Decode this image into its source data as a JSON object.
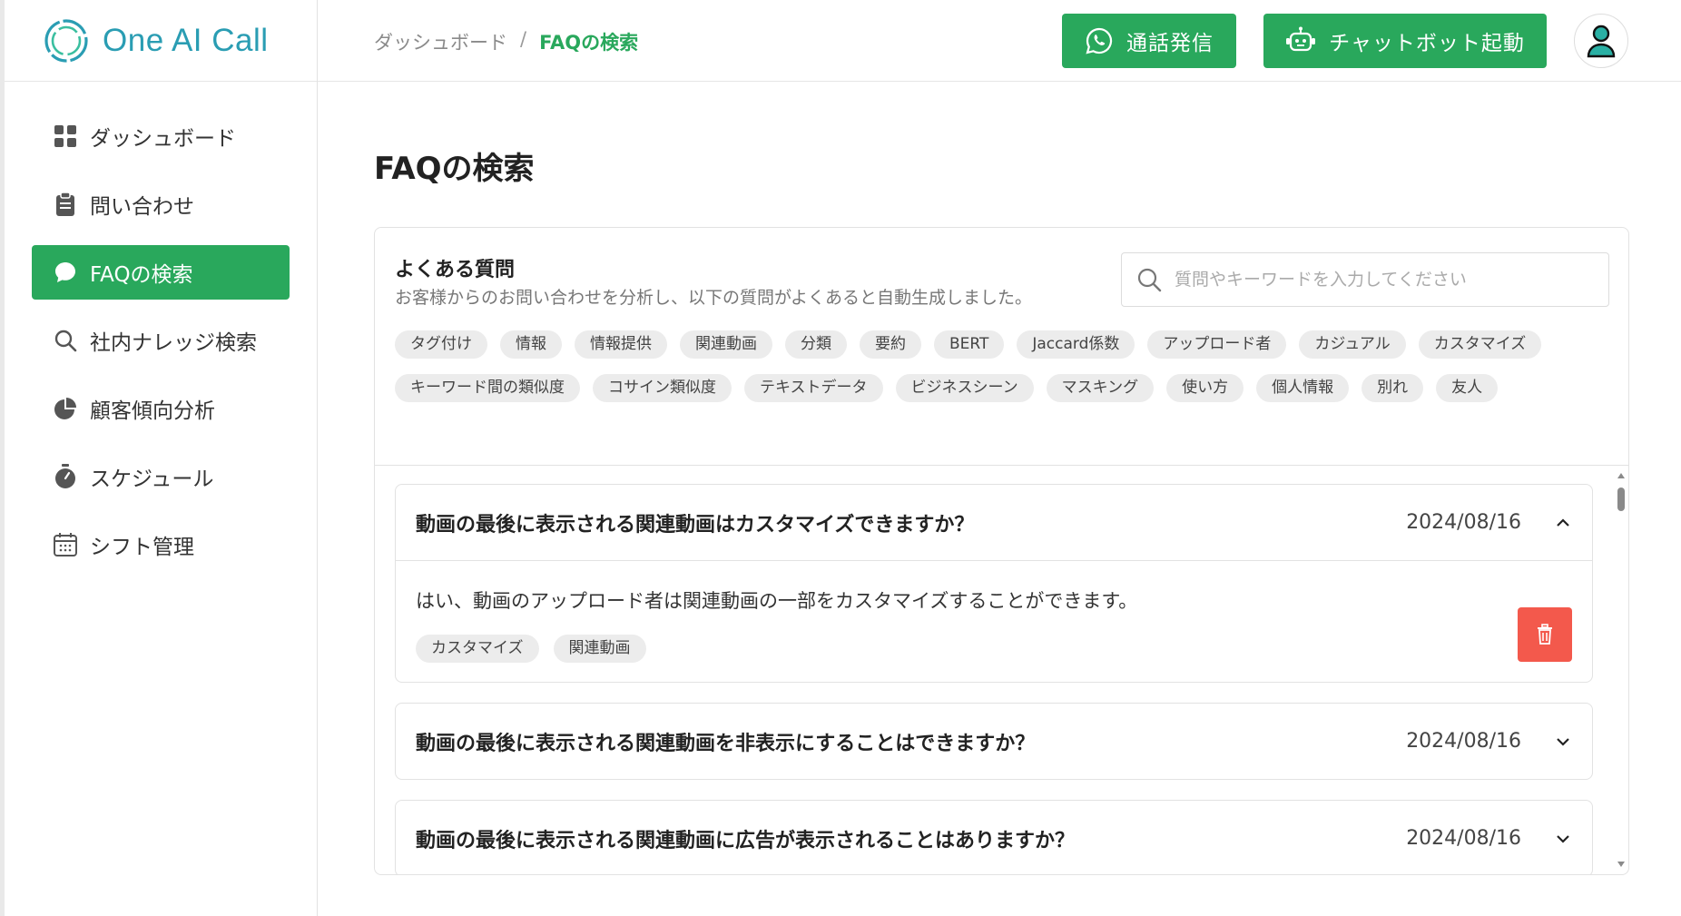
{
  "brand": {
    "name": "One AI Call",
    "color": "#2a9db3"
  },
  "accent": "#29a85c",
  "danger": "#f3594c",
  "sidebar": {
    "items": [
      {
        "label": "ダッシュボード",
        "icon": "grid-icon",
        "active": false
      },
      {
        "label": "問い合わせ",
        "icon": "clipboard-icon",
        "active": false
      },
      {
        "label": "FAQの検索",
        "icon": "chat-bubble-icon",
        "active": true
      },
      {
        "label": "社内ナレッジ検索",
        "icon": "search-icon",
        "active": false
      },
      {
        "label": "顧客傾向分析",
        "icon": "pie-chart-icon",
        "active": false
      },
      {
        "label": "スケジュール",
        "icon": "timer-icon",
        "active": false
      },
      {
        "label": "シフト管理",
        "icon": "calendar-icon",
        "active": false
      }
    ]
  },
  "header": {
    "breadcrumb": {
      "root": "ダッシュボード",
      "separator": "/",
      "current": "FAQの検索"
    },
    "call_button": "通話発信",
    "chatbot_button": "チャットボット起動"
  },
  "main": {
    "title": "FAQの検索",
    "card": {
      "title": "よくある質問",
      "description": "お客様からのお問い合わせを分析し、以下の質問がよくあると自動生成しました。",
      "search_placeholder": "質問やキーワードを入力してください",
      "tags": [
        "タグ付け",
        "情報",
        "情報提供",
        "関連動画",
        "分類",
        "要約",
        "BERT",
        "Jaccard係数",
        "アップロード者",
        "カジュアル",
        "カスタマイズ",
        "キーワード間の類似度",
        "コサイン類似度",
        "テキストデータ",
        "ビジネスシーン",
        "マスキング",
        "使い方",
        "個人情報",
        "別れ",
        "友人"
      ]
    },
    "faqs": [
      {
        "question": "動画の最後に表示される関連動画はカスタマイズできますか？",
        "date": "2024/08/16",
        "expanded": true,
        "answer": "はい、動画のアップロード者は関連動画の一部をカスタマイズすることができます。",
        "tags": [
          "カスタマイズ",
          "関連動画"
        ]
      },
      {
        "question": "動画の最後に表示される関連動画を非表示にすることはできますか？",
        "date": "2024/08/16",
        "expanded": false
      },
      {
        "question": "動画の最後に表示される関連動画に広告が表示されることはありますか？",
        "date": "2024/08/16",
        "expanded": false
      }
    ]
  }
}
